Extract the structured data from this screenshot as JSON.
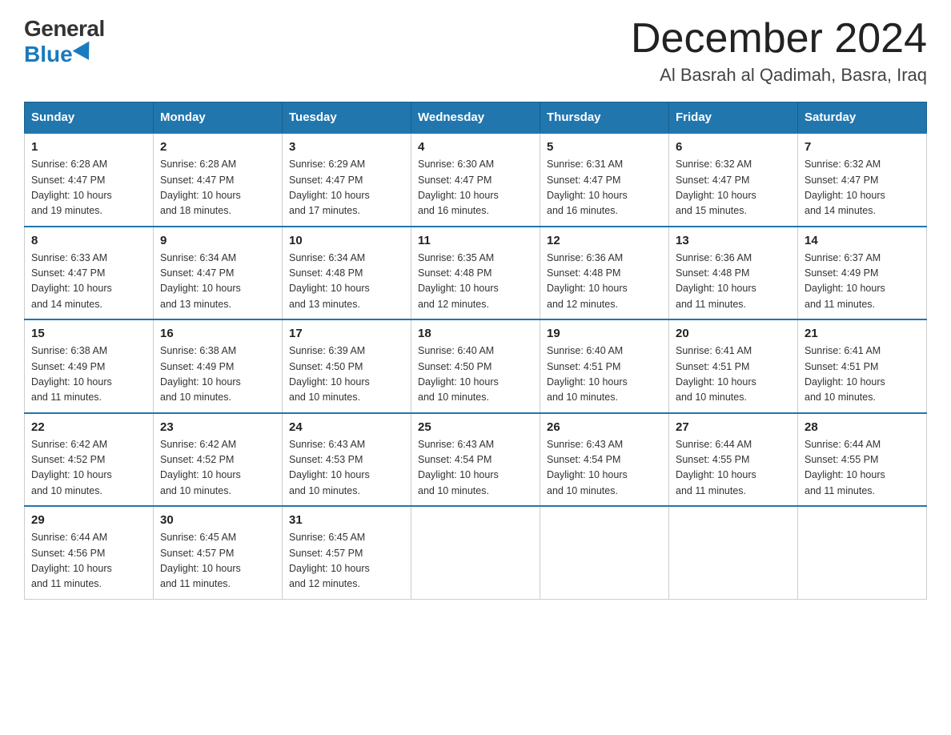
{
  "logo": {
    "general": "General",
    "blue": "Blue"
  },
  "title": "December 2024",
  "location": "Al Basrah al Qadimah, Basra, Iraq",
  "headers": [
    "Sunday",
    "Monday",
    "Tuesday",
    "Wednesday",
    "Thursday",
    "Friday",
    "Saturday"
  ],
  "weeks": [
    [
      {
        "day": "1",
        "sunrise": "6:28 AM",
        "sunset": "4:47 PM",
        "daylight": "10 hours and 19 minutes."
      },
      {
        "day": "2",
        "sunrise": "6:28 AM",
        "sunset": "4:47 PM",
        "daylight": "10 hours and 18 minutes."
      },
      {
        "day": "3",
        "sunrise": "6:29 AM",
        "sunset": "4:47 PM",
        "daylight": "10 hours and 17 minutes."
      },
      {
        "day": "4",
        "sunrise": "6:30 AM",
        "sunset": "4:47 PM",
        "daylight": "10 hours and 16 minutes."
      },
      {
        "day": "5",
        "sunrise": "6:31 AM",
        "sunset": "4:47 PM",
        "daylight": "10 hours and 16 minutes."
      },
      {
        "day": "6",
        "sunrise": "6:32 AM",
        "sunset": "4:47 PM",
        "daylight": "10 hours and 15 minutes."
      },
      {
        "day": "7",
        "sunrise": "6:32 AM",
        "sunset": "4:47 PM",
        "daylight": "10 hours and 14 minutes."
      }
    ],
    [
      {
        "day": "8",
        "sunrise": "6:33 AM",
        "sunset": "4:47 PM",
        "daylight": "10 hours and 14 minutes."
      },
      {
        "day": "9",
        "sunrise": "6:34 AM",
        "sunset": "4:47 PM",
        "daylight": "10 hours and 13 minutes."
      },
      {
        "day": "10",
        "sunrise": "6:34 AM",
        "sunset": "4:48 PM",
        "daylight": "10 hours and 13 minutes."
      },
      {
        "day": "11",
        "sunrise": "6:35 AM",
        "sunset": "4:48 PM",
        "daylight": "10 hours and 12 minutes."
      },
      {
        "day": "12",
        "sunrise": "6:36 AM",
        "sunset": "4:48 PM",
        "daylight": "10 hours and 12 minutes."
      },
      {
        "day": "13",
        "sunrise": "6:36 AM",
        "sunset": "4:48 PM",
        "daylight": "10 hours and 11 minutes."
      },
      {
        "day": "14",
        "sunrise": "6:37 AM",
        "sunset": "4:49 PM",
        "daylight": "10 hours and 11 minutes."
      }
    ],
    [
      {
        "day": "15",
        "sunrise": "6:38 AM",
        "sunset": "4:49 PM",
        "daylight": "10 hours and 11 minutes."
      },
      {
        "day": "16",
        "sunrise": "6:38 AM",
        "sunset": "4:49 PM",
        "daylight": "10 hours and 10 minutes."
      },
      {
        "day": "17",
        "sunrise": "6:39 AM",
        "sunset": "4:50 PM",
        "daylight": "10 hours and 10 minutes."
      },
      {
        "day": "18",
        "sunrise": "6:40 AM",
        "sunset": "4:50 PM",
        "daylight": "10 hours and 10 minutes."
      },
      {
        "day": "19",
        "sunrise": "6:40 AM",
        "sunset": "4:51 PM",
        "daylight": "10 hours and 10 minutes."
      },
      {
        "day": "20",
        "sunrise": "6:41 AM",
        "sunset": "4:51 PM",
        "daylight": "10 hours and 10 minutes."
      },
      {
        "day": "21",
        "sunrise": "6:41 AM",
        "sunset": "4:51 PM",
        "daylight": "10 hours and 10 minutes."
      }
    ],
    [
      {
        "day": "22",
        "sunrise": "6:42 AM",
        "sunset": "4:52 PM",
        "daylight": "10 hours and 10 minutes."
      },
      {
        "day": "23",
        "sunrise": "6:42 AM",
        "sunset": "4:52 PM",
        "daylight": "10 hours and 10 minutes."
      },
      {
        "day": "24",
        "sunrise": "6:43 AM",
        "sunset": "4:53 PM",
        "daylight": "10 hours and 10 minutes."
      },
      {
        "day": "25",
        "sunrise": "6:43 AM",
        "sunset": "4:54 PM",
        "daylight": "10 hours and 10 minutes."
      },
      {
        "day": "26",
        "sunrise": "6:43 AM",
        "sunset": "4:54 PM",
        "daylight": "10 hours and 10 minutes."
      },
      {
        "day": "27",
        "sunrise": "6:44 AM",
        "sunset": "4:55 PM",
        "daylight": "10 hours and 11 minutes."
      },
      {
        "day": "28",
        "sunrise": "6:44 AM",
        "sunset": "4:55 PM",
        "daylight": "10 hours and 11 minutes."
      }
    ],
    [
      {
        "day": "29",
        "sunrise": "6:44 AM",
        "sunset": "4:56 PM",
        "daylight": "10 hours and 11 minutes."
      },
      {
        "day": "30",
        "sunrise": "6:45 AM",
        "sunset": "4:57 PM",
        "daylight": "10 hours and 11 minutes."
      },
      {
        "day": "31",
        "sunrise": "6:45 AM",
        "sunset": "4:57 PM",
        "daylight": "10 hours and 12 minutes."
      },
      null,
      null,
      null,
      null
    ]
  ]
}
